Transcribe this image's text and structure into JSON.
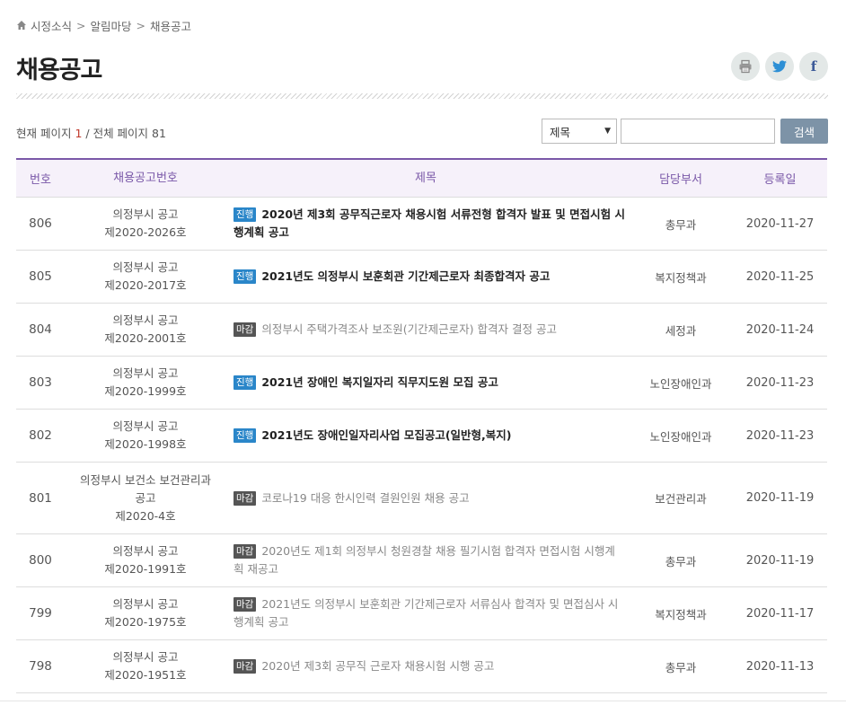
{
  "breadcrumb": {
    "items": [
      "시정소식",
      "알림마당",
      "채용공고"
    ]
  },
  "page": {
    "title": "채용공고"
  },
  "pageinfo": {
    "prefix": "현재 페이지 ",
    "current": "1",
    "suffix": " / 전체 페이지 81"
  },
  "search": {
    "select_value": "제목",
    "input_value": "",
    "button_label": "검색"
  },
  "colors": {
    "accent": "#7a58a8",
    "open_badge": "#2a86c9",
    "closed_badge": "#555555"
  },
  "table": {
    "headers": {
      "num": "번호",
      "code": "채용공고번호",
      "title": "제목",
      "dept": "담당부서",
      "date": "등록일"
    },
    "rows": [
      {
        "num": "806",
        "code": [
          "의정부시 공고",
          "제2020-2026호"
        ],
        "badge": "진행",
        "status": "open",
        "title": "2020년 제3회 공무직근로자 채용시험 서류전형 합격자 발표 및 면접시험 시행계획 공고",
        "dept": "총무과",
        "date": "2020-11-27"
      },
      {
        "num": "805",
        "code": [
          "의정부시 공고",
          "제2020-2017호"
        ],
        "badge": "진행",
        "status": "open",
        "title": "2021년도 의정부시 보훈회관 기간제근로자 최종합격자 공고",
        "dept": "복지정책과",
        "date": "2020-11-25"
      },
      {
        "num": "804",
        "code": [
          "의정부시 공고",
          "제2020-2001호"
        ],
        "badge": "마감",
        "status": "closed",
        "title": "의정부시 주택가격조사 보조원(기간제근로자) 합격자 결정 공고",
        "dept": "세정과",
        "date": "2020-11-24"
      },
      {
        "num": "803",
        "code": [
          "의정부시 공고",
          "제2020-1999호"
        ],
        "badge": "진행",
        "status": "open",
        "title": "2021년 장애인 복지일자리 직무지도원 모집 공고",
        "dept": "노인장애인과",
        "date": "2020-11-23"
      },
      {
        "num": "802",
        "code": [
          "의정부시 공고",
          "제2020-1998호"
        ],
        "badge": "진행",
        "status": "open",
        "title": "2021년도 장애인일자리사업 모집공고(일반형,복지)",
        "dept": "노인장애인과",
        "date": "2020-11-23"
      },
      {
        "num": "801",
        "code": [
          "의정부시 보건소 보건관리과",
          "공고",
          "제2020-4호"
        ],
        "badge": "마감",
        "status": "closed",
        "title": "코로나19 대응 한시인력 결원인원 채용 공고",
        "dept": "보건관리과",
        "date": "2020-11-19"
      },
      {
        "num": "800",
        "code": [
          "의정부시 공고",
          "제2020-1991호"
        ],
        "badge": "마감",
        "status": "closed",
        "title": "2020년도 제1회 의정부시 청원경찰 채용 필기시험 합격자 면접시험 시행계획 재공고",
        "dept": "총무과",
        "date": "2020-11-19"
      },
      {
        "num": "799",
        "code": [
          "의정부시 공고",
          "제2020-1975호"
        ],
        "badge": "마감",
        "status": "closed",
        "title": "2021년도 의정부시 보훈회관 기간제근로자 서류심사 합격자 및 면접심사 시행계획 공고",
        "dept": "복지정책과",
        "date": "2020-11-17"
      },
      {
        "num": "798",
        "code": [
          "의정부시 공고",
          "제2020-1951호"
        ],
        "badge": "마감",
        "status": "closed",
        "title": "2020년 제3회 공무직 근로자 채용시험 시행 공고",
        "dept": "총무과",
        "date": "2020-11-13"
      }
    ]
  }
}
